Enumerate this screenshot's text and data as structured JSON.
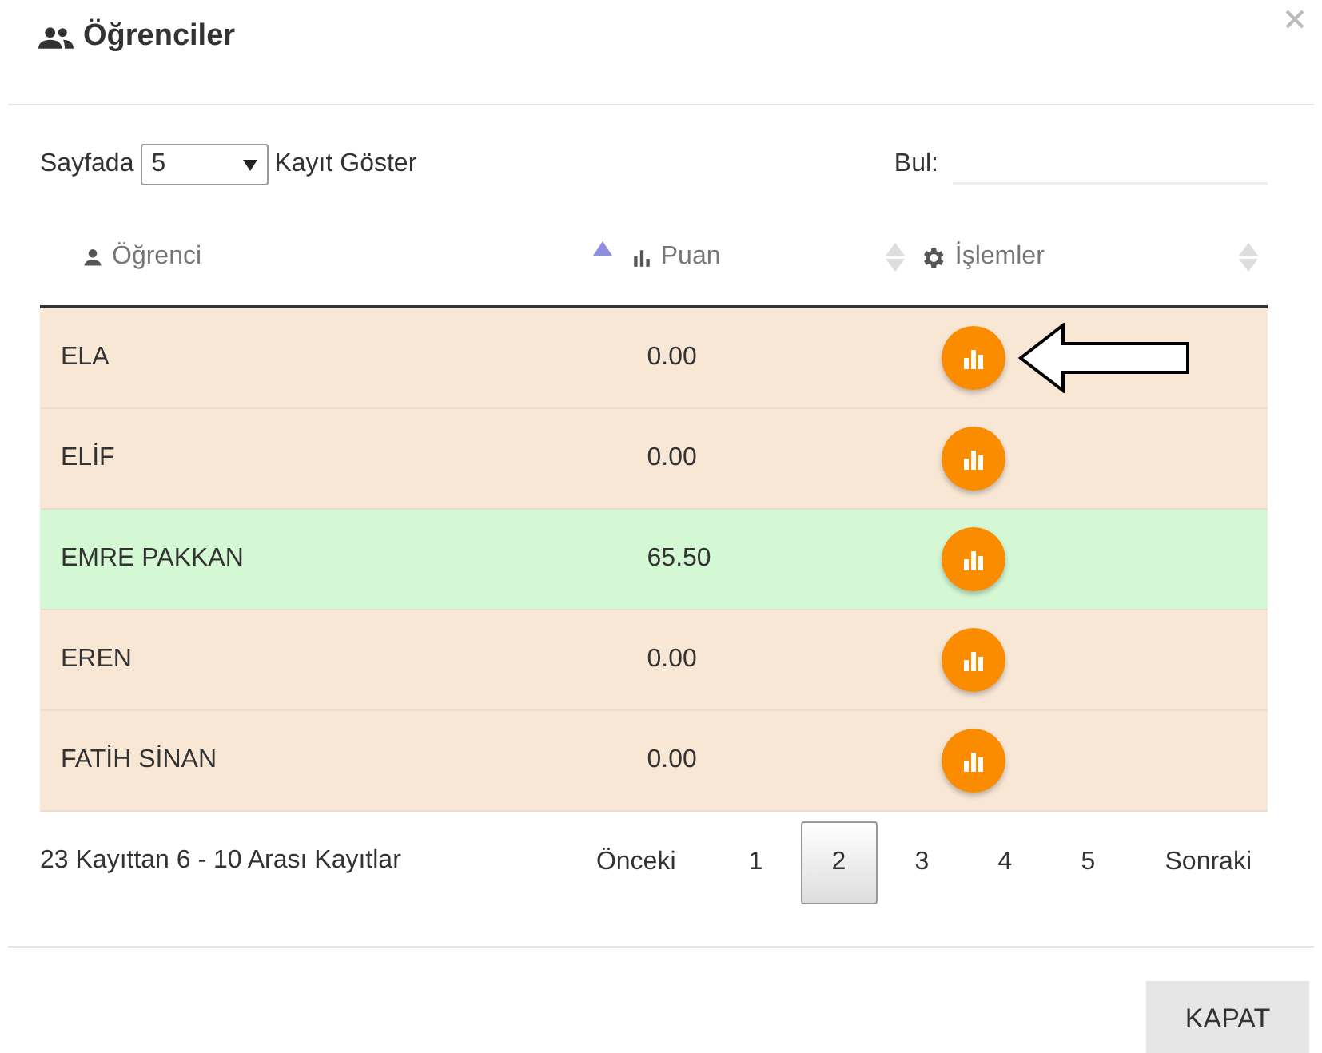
{
  "dialog": {
    "title": "Öğrenciler"
  },
  "controls": {
    "length_prefix": "Sayfada",
    "length_value": "5",
    "length_suffix": "Kayıt Göster",
    "search_label": "Bul:"
  },
  "table": {
    "columns": [
      {
        "label": "Öğrenci",
        "sorted": true
      },
      {
        "label": "Puan",
        "sorted": false
      },
      {
        "label": "İşlemler",
        "sorted": false
      }
    ],
    "rows": [
      {
        "name": "ELA",
        "score": "0.00",
        "highlighted": false,
        "pointed": true
      },
      {
        "name": "ELİF",
        "score": "0.00",
        "highlighted": false,
        "pointed": false
      },
      {
        "name": "EMRE PAKKAN",
        "score": "65.50",
        "highlighted": true,
        "pointed": false
      },
      {
        "name": "EREN",
        "score": "0.00",
        "highlighted": false,
        "pointed": false
      },
      {
        "name": "FATİH SİNAN",
        "score": "0.00",
        "highlighted": false,
        "pointed": false
      }
    ]
  },
  "info": "23 Kayıttan 6 - 10 Arası Kayıtlar",
  "pagination": {
    "previous": "Önceki",
    "next": "Sonraki",
    "pages": [
      {
        "label": "1",
        "selected": false
      },
      {
        "label": "2",
        "selected": true
      },
      {
        "label": "3",
        "selected": false
      },
      {
        "label": "4",
        "selected": false
      },
      {
        "label": "5",
        "selected": false
      }
    ]
  },
  "footer": {
    "close_button": "KAPAT"
  }
}
